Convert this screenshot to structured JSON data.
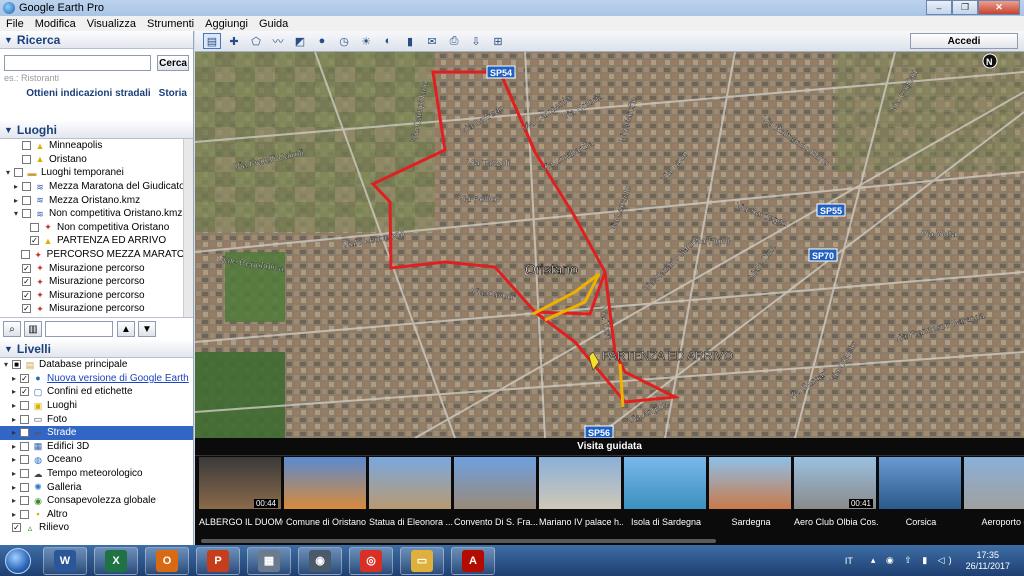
{
  "window": {
    "title": "Google Earth Pro",
    "min": "–",
    "max": "❐",
    "close": "✕"
  },
  "menu": [
    "File",
    "Modifica",
    "Visualizza",
    "Strumenti",
    "Aggiungi",
    "Guida"
  ],
  "search": {
    "header": "Ricerca",
    "button": "Cerca",
    "placeholder": "es.: Ristoranti",
    "link_directions": "Ottieni indicazioni stradali",
    "link_history": "Storia"
  },
  "places": {
    "header": "Luoghi",
    "items": [
      {
        "label": "Minneapolis",
        "indent": 1,
        "icon": "pin-icon",
        "checked": false
      },
      {
        "label": "Oristano",
        "indent": 1,
        "icon": "pin-icon",
        "checked": false
      },
      {
        "label": "Luoghi temporanei",
        "indent": 0,
        "icon": "folder-icon",
        "checked": false
      },
      {
        "label": "Mezza Maratona del Giudicato...",
        "indent": 1,
        "icon": "kml-icon",
        "checked": false
      },
      {
        "label": "Mezza Oristano.kmz",
        "indent": 1,
        "icon": "kml-icon",
        "checked": false
      },
      {
        "label": "Non competitiva Oristano.kmz",
        "indent": 1,
        "icon": "kml-icon",
        "checked": false
      },
      {
        "label": "Non competitiva Oristano",
        "indent": 2,
        "icon": "path-icon",
        "checked": false
      },
      {
        "label": "PARTENZA ED ARRIVO",
        "indent": 2,
        "icon": "pin-icon",
        "checked": true
      },
      {
        "label": "PERCORSO MEZZA MARATO...",
        "indent": 1,
        "icon": "path-icon",
        "checked": false
      },
      {
        "label": "Misurazione percorso",
        "indent": 1,
        "icon": "path-icon",
        "checked": true
      },
      {
        "label": "Misurazione percorso",
        "indent": 1,
        "icon": "path-icon",
        "checked": true
      },
      {
        "label": "Misurazione percorso",
        "indent": 1,
        "icon": "path-icon",
        "checked": true
      },
      {
        "label": "Misurazione percorso",
        "indent": 1,
        "icon": "path-icon",
        "checked": true
      }
    ]
  },
  "layers": {
    "header": "Livelli",
    "items": [
      {
        "label": "Database principale",
        "icon": "database-icon",
        "checked": null,
        "link": false,
        "selected": false
      },
      {
        "label": "Nuova versione di Google Earth",
        "icon": "globe-icon",
        "checked": true,
        "link": true,
        "selected": false
      },
      {
        "label": "Confini ed etichette",
        "icon": "borders-icon",
        "checked": true,
        "link": false,
        "selected": false
      },
      {
        "label": "Luoghi",
        "icon": "places-icon",
        "checked": false,
        "link": false,
        "selected": false
      },
      {
        "label": "Foto",
        "icon": "photo-icon",
        "checked": false,
        "link": false,
        "selected": false
      },
      {
        "label": "Strade",
        "icon": "road-icon",
        "checked": true,
        "link": false,
        "selected": true
      },
      {
        "label": "Edifici 3D",
        "icon": "buildings-icon",
        "checked": false,
        "link": false,
        "selected": false
      },
      {
        "label": "Oceano",
        "icon": "ocean-icon",
        "checked": false,
        "link": false,
        "selected": false
      },
      {
        "label": "Tempo meteorologico",
        "icon": "weather-icon",
        "checked": false,
        "link": false,
        "selected": false
      },
      {
        "label": "Galleria",
        "icon": "gallery-icon",
        "checked": false,
        "link": false,
        "selected": false
      },
      {
        "label": "Consapevolezza globale",
        "icon": "awareness-icon",
        "checked": false,
        "link": false,
        "selected": false
      },
      {
        "label": "Altro",
        "icon": "other-icon",
        "checked": false,
        "link": false,
        "selected": false
      },
      {
        "label": "Rilievo",
        "icon": "terrain-icon",
        "checked": true,
        "link": false,
        "selected": false
      }
    ]
  },
  "toolbar": {
    "accedi": "Accedi"
  },
  "map": {
    "labels": [
      {
        "text": "Oristano",
        "size": 14
      },
      {
        "text": "PARTENZA ED ARRIVO",
        "size": 12
      }
    ],
    "shields": [
      "SP54",
      "SP55",
      "SP70",
      "SP56"
    ],
    "streets": [
      "Via Campidano",
      "Via Loffredo",
      "Via Campania",
      "Via Umbria",
      "Via Fratelli Cairoli",
      "Via Tazzoli",
      "Via Lombardia",
      "Via Pellico",
      "Viale Leone XIII",
      "Viale Repubblica",
      "Via Cavour",
      "Via Sardegna",
      "Via Figoli",
      "Viale Diaz",
      "Via Volta",
      "Via Raimondo Bonu",
      "Via Francesco Baracca",
      "Via Sassari",
      "Via Angioy",
      "Via Nazario Sauro",
      "Via Lazio",
      "Via Marche",
      "Via Tirso",
      "Via Lepanto",
      "Via Gialeto",
      "Via Cagliari"
    ],
    "north": "N"
  },
  "tour": {
    "title": "Visita guidata",
    "items": [
      {
        "caption": "ALBERGO IL DUOMO",
        "duration": "00:44"
      },
      {
        "caption": "Comune di Oristano",
        "duration": ""
      },
      {
        "caption": "Statua di Eleonora ...",
        "duration": ""
      },
      {
        "caption": "Convento Di S. Fra...",
        "duration": ""
      },
      {
        "caption": "Mariano IV palace h...",
        "duration": ""
      },
      {
        "caption": "Isola di Sardegna",
        "duration": ""
      },
      {
        "caption": "Sardegna",
        "duration": ""
      },
      {
        "caption": "Aero Club Olbia Cos...",
        "duration": "00:41"
      },
      {
        "caption": "Corsica",
        "duration": ""
      },
      {
        "caption": "Aeroporto di",
        "duration": ""
      }
    ]
  },
  "taskbar": {
    "apps": [
      {
        "name": "word-icon",
        "glyph": "W",
        "color": "#2b579a"
      },
      {
        "name": "excel-icon",
        "glyph": "X",
        "color": "#1f7244"
      },
      {
        "name": "outlook-icon",
        "glyph": "O",
        "color": "#d86a13"
      },
      {
        "name": "powerpoint-icon",
        "glyph": "P",
        "color": "#c43e1c"
      },
      {
        "name": "calculator-icon",
        "glyph": "▦",
        "color": "#6b7a8f"
      },
      {
        "name": "google-earth-icon",
        "glyph": "◉",
        "color": "#4a5a6a"
      },
      {
        "name": "chrome-icon",
        "glyph": "◎",
        "color": "#d93025"
      },
      {
        "name": "explorer-icon",
        "glyph": "▭",
        "color": "#e0b03c"
      },
      {
        "name": "pdf-icon",
        "glyph": "A",
        "color": "#b30b00"
      }
    ],
    "lang": "IT",
    "time": "17:35",
    "date": "26/11/2017"
  }
}
